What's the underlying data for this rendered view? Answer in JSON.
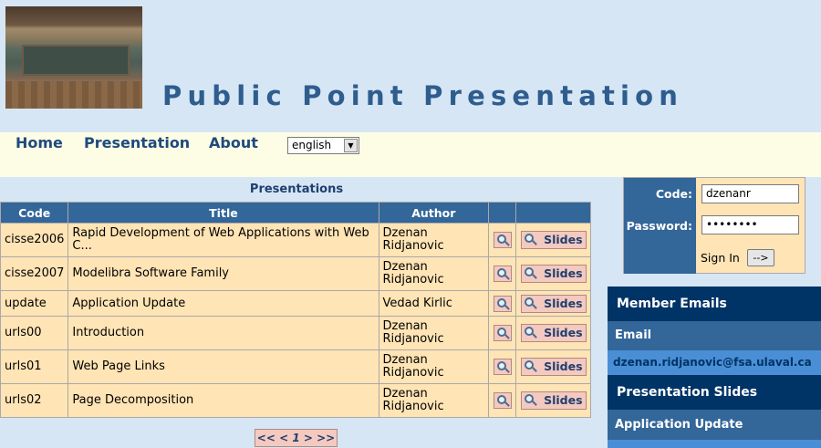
{
  "header": {
    "title": "Public Point Presentation"
  },
  "nav": {
    "items": [
      "Home",
      "Presentation",
      "About"
    ],
    "language": "english"
  },
  "presentations": {
    "caption": "Presentations",
    "columns": [
      "Code",
      "Title",
      "Author"
    ],
    "rows": [
      {
        "code": "cisse2006",
        "title": "Rapid Development of Web Applications with Web C...",
        "author": "Dzenan Ridjanovic"
      },
      {
        "code": "cisse2007",
        "title": "Modelibra Software Family",
        "author": "Dzenan Ridjanovic"
      },
      {
        "code": "update",
        "title": "Application Update",
        "author": "Vedad Kirlic"
      },
      {
        "code": "urls00",
        "title": "Introduction",
        "author": "Dzenan Ridjanovic"
      },
      {
        "code": "urls01",
        "title": "Web Page Links",
        "author": "Dzenan Ridjanovic"
      },
      {
        "code": "urls02",
        "title": "Page Decomposition",
        "author": "Dzenan Ridjanovic"
      }
    ],
    "slides_label": "Slides",
    "pager": "<< < 1 > >>"
  },
  "login": {
    "code_label": "Code:",
    "code_value": "dzenanr",
    "password_label": "Password:",
    "password_value": "••••••••",
    "signin_label": "Sign In",
    "signin_button": "-->"
  },
  "sidebar": {
    "member_emails": "Member Emails",
    "email_header": "Email",
    "email": "dzenan.ridjanovic@fsa.ulaval.ca",
    "presentation_slides": "Presentation Slides",
    "slide_link": "Application Update"
  },
  "colors": {
    "page_bg": "#d6e6f5",
    "menu_bg": "#fdfde6",
    "table_header": "#336699",
    "table_cell": "#ffe4b5",
    "sidebar_dark": "#003366"
  }
}
